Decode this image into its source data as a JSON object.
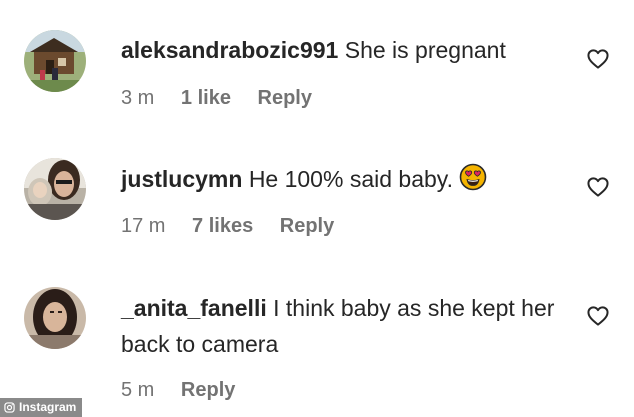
{
  "comments": [
    {
      "username": "aleksandrabozic991",
      "text": "She is pregnant",
      "time": "3 m",
      "likes": "1 like",
      "reply": "Reply",
      "avatar_icon": "avatar-cabin-photo"
    },
    {
      "username": "justlucymn",
      "text": "He 100% said baby.",
      "emoji": "heart-eyes-emoji",
      "time": "17 m",
      "likes": "7 likes",
      "reply": "Reply",
      "avatar_icon": "avatar-selfie-photo"
    },
    {
      "username": "_anita_fanelli",
      "text": "I think baby as she kept her back to camera",
      "time": "5 m",
      "reply": "Reply",
      "avatar_icon": "avatar-dark-hair-photo"
    }
  ],
  "watermark": {
    "label": "Instagram",
    "icon": "instagram-camera-icon"
  },
  "colors": {
    "text": "#262626",
    "meta": "#737373",
    "emoji_face": "#f5b400",
    "emoji_heart": "#e0245e"
  }
}
